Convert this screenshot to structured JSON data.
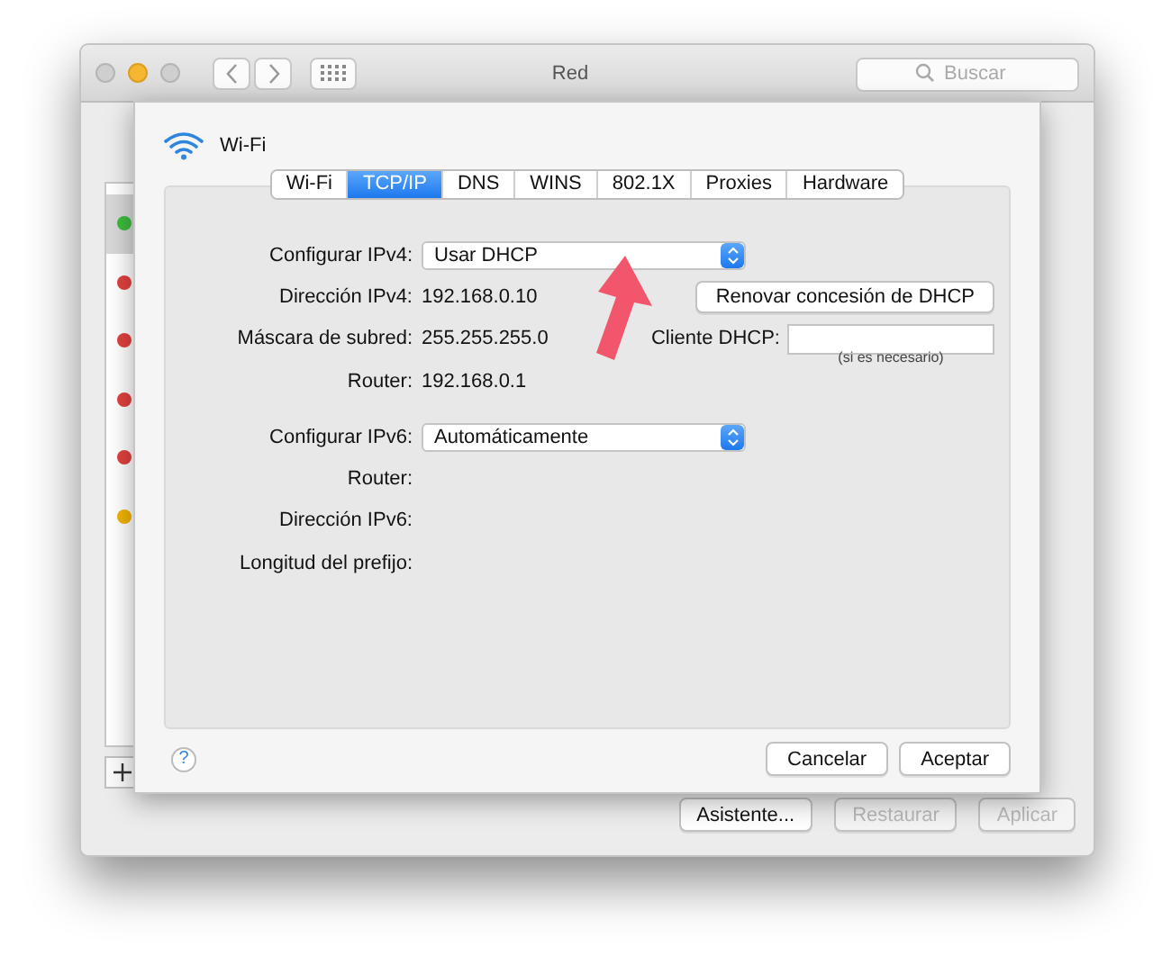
{
  "window": {
    "title": "Red",
    "search": {
      "placeholder": "Buscar"
    }
  },
  "services": [
    {
      "color": "#3dbb3d",
      "selected": true
    },
    {
      "color": "#e0413e",
      "selected": false
    },
    {
      "color": "#e0413e",
      "selected": false
    },
    {
      "color": "#e0413e",
      "selected": false
    },
    {
      "color": "#e0413e",
      "selected": false
    },
    {
      "color": "#f0b400",
      "selected": false
    }
  ],
  "window_buttons": [
    {
      "label": "Asistente...",
      "disabled": false
    },
    {
      "label": "Restaurar",
      "disabled": true
    },
    {
      "label": "Aplicar",
      "disabled": true
    }
  ],
  "sheet": {
    "interface": "Wi-Fi",
    "tabs": [
      {
        "label": "Wi-Fi",
        "selected": false
      },
      {
        "label": "TCP/IP",
        "selected": true
      },
      {
        "label": "DNS",
        "selected": false
      },
      {
        "label": "WINS",
        "selected": false
      },
      {
        "label": "802.1X",
        "selected": false
      },
      {
        "label": "Proxies",
        "selected": false
      },
      {
        "label": "Hardware",
        "selected": false
      }
    ],
    "rows": [
      {
        "kind": "popup",
        "label": "Configurar IPv4:",
        "value": "Usar DHCP"
      },
      {
        "kind": "value",
        "label": "Dirección IPv4:",
        "value": "192.168.0.10"
      },
      {
        "kind": "value",
        "label": "Máscara de subred:",
        "value": "255.255.255.0"
      },
      {
        "kind": "value",
        "label": "Router:",
        "value": "192.168.0.1"
      },
      {
        "kind": "gap"
      },
      {
        "kind": "popup",
        "label": "Configurar IPv6:",
        "value": "Automáticamente"
      },
      {
        "kind": "value",
        "label": "Router:"
      },
      {
        "kind": "value",
        "label": "Dirección IPv6:"
      },
      {
        "kind": "value",
        "label": "Longitud del prefijo:"
      }
    ],
    "renew_button": "Renovar concesión de DHCP",
    "dhcp_client": {
      "label": "Cliente DHCP:",
      "hint": "(si es necesario)"
    },
    "help": "?",
    "buttons": [
      "Cancelar",
      "Aceptar"
    ]
  }
}
